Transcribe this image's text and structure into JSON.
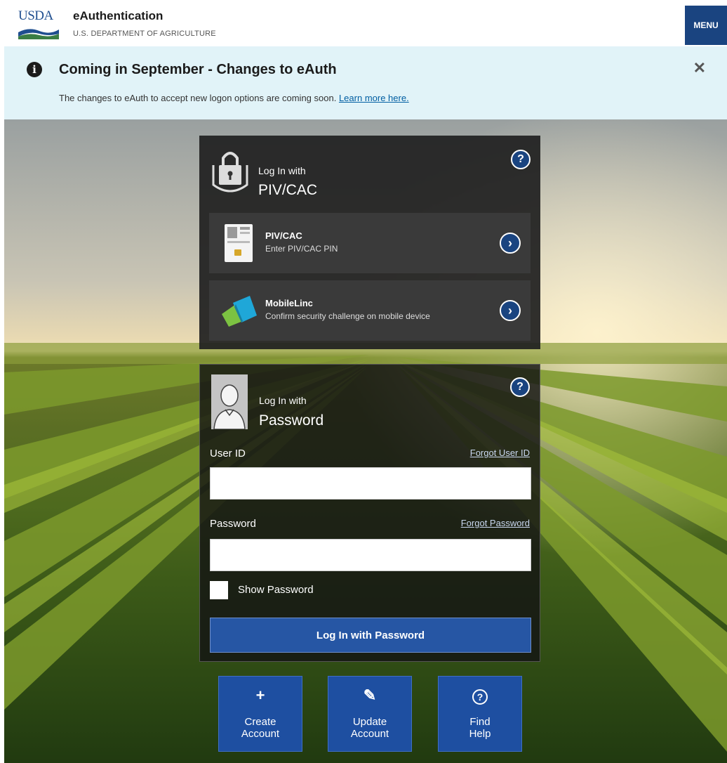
{
  "header": {
    "logo_text": "USDA",
    "app_title": "eAuthentication",
    "app_subtitle": "U.S. DEPARTMENT OF AGRICULTURE",
    "menu_label": "MENU"
  },
  "banner": {
    "title": "Coming in September - Changes to eAuth",
    "text": "The changes to eAuth to accept new logon options are coming soon.",
    "link_text": "Learn more here.",
    "close_symbol": "✕"
  },
  "piv_panel": {
    "login_with": "Log In with",
    "title": "PIV/CAC",
    "help_symbol": "?",
    "options": [
      {
        "title": "PIV/CAC",
        "description": "Enter PIV/CAC PIN",
        "icon": "smart-card-icon"
      },
      {
        "title": "MobileLinc",
        "description": "Confirm security challenge on mobile device",
        "icon": "mobilelinc-icon"
      }
    ]
  },
  "password_panel": {
    "login_with": "Log In with",
    "title": "Password",
    "help_symbol": "?",
    "user_id_label": "User ID",
    "forgot_user_id": "Forgot User ID",
    "user_id_value": "",
    "password_label": "Password",
    "forgot_password": "Forgot Password",
    "password_value": "",
    "show_password_label": "Show Password",
    "submit_label": "Log In with Password"
  },
  "tiles": [
    {
      "icon": "plus-icon",
      "symbol": "+",
      "label_line1": "Create",
      "label_line2": "Account"
    },
    {
      "icon": "pencil-icon",
      "symbol": "✎",
      "label_line1": "Update",
      "label_line2": "Account"
    },
    {
      "icon": "help-circle-icon",
      "symbol": "?",
      "label_line1": "Find",
      "label_line2": "Help"
    }
  ],
  "colors": {
    "primary_blue": "#1a4480",
    "banner_bg": "#e1f3f8",
    "panel_dark": "#202020"
  }
}
